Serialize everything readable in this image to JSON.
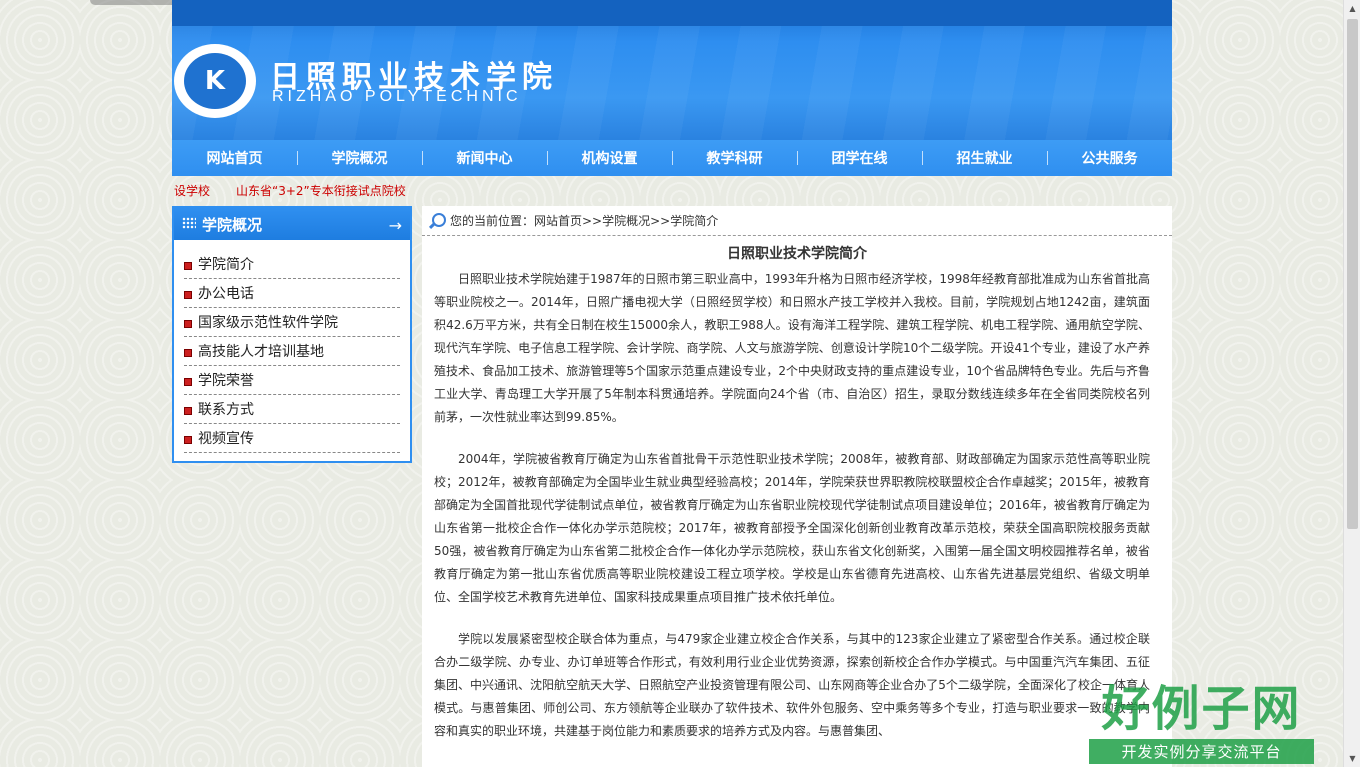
{
  "header": {
    "school_name_cn": "日照职业技术学院",
    "school_name_en": "RIZHAO POLYTECHNIC",
    "logo_mark": "K"
  },
  "nav": {
    "items": [
      "网站首页",
      "学院概况",
      "新闻中心",
      "机构设置",
      "教学科研",
      "团学在线",
      "招生就业",
      "公共服务"
    ]
  },
  "marquee": {
    "items": [
      "设学校",
      "山东省“3+2”专本衔接试点院校"
    ]
  },
  "sidebar": {
    "title": "学院概况",
    "items": [
      "学院简介",
      "办公电话",
      "国家级示范性软件学院",
      "高技能人才培训基地",
      "学院荣誉",
      "联系方式",
      "视频宣传"
    ]
  },
  "breadcrumb": {
    "text": "您的当前位置：网站首页>>学院概况>>学院简介"
  },
  "article": {
    "title": "日照职业技术学院简介",
    "paragraphs": [
      "日照职业技术学院始建于1987年的日照市第三职业高中，1993年升格为日照市经济学校，1998年经教育部批准成为山东省首批高等职业院校之一。2014年，日照广播电视大学（日照经贸学校）和日照水产技工学校并入我校。目前，学院规划占地1242亩，建筑面积42.6万平方米，共有全日制在校生15000余人，教职工988人。设有海洋工程学院、建筑工程学院、机电工程学院、通用航空学院、现代汽车学院、电子信息工程学院、会计学院、商学院、人文与旅游学院、创意设计学院10个二级学院。开设41个专业，建设了水产养殖技术、食品加工技术、旅游管理等5个国家示范重点建设专业，2个中央财政支持的重点建设专业，10个省品牌特色专业。先后与齐鲁工业大学、青岛理工大学开展了5年制本科贯通培养。学院面向24个省（市、自治区）招生，录取分数线连续多年在全省同类院校名列前茅，一次性就业率达到99.85%。",
      "2004年，学院被省教育厅确定为山东省首批骨干示范性职业技术学院；2008年，被教育部、财政部确定为国家示范性高等职业院校；2012年，被教育部确定为全国毕业生就业典型经验高校；2014年，学院荣获世界职教院校联盟校企合作卓越奖；2015年，被教育部确定为全国首批现代学徒制试点单位，被省教育厅确定为山东省职业院校现代学徒制试点项目建设单位；2016年，被省教育厅确定为山东省第一批校企合作一体化办学示范院校；2017年，被教育部授予全国深化创新创业教育改革示范校，荣获全国高职院校服务贡献50强，被省教育厅确定为山东省第二批校企合作一体化办学示范院校，获山东省文化创新奖，入围第一届全国文明校园推荐名单，被省教育厅确定为第一批山东省优质高等职业院校建设工程立项学校。学校是山东省德育先进高校、山东省先进基层党组织、省级文明单位、全国学校艺术教育先进单位、国家科技成果重点项目推广技术依托单位。",
      "学院以发展紧密型校企联合体为重点，与479家企业建立校企合作关系，与其中的123家企业建立了紧密型合作关系。通过校企联合办二级学院、办专业、办订单班等合作形式，有效利用行业企业优势资源，探索创新校企合作办学模式。与中国重汽汽车集团、五征集团、中兴通讯、沈阳航空航天大学、日照航空产业投资管理有限公司、山东网商等企业合办了5个二级学院，全面深化了校企一体育人模式。与惠普集团、师创公司、东方领航等企业联办了软件技术、软件外包服务、空中乘务等多个专业，打造与职业要求一致的教学内容和真实的职业环境，共建基于岗位能力和素质要求的培养方式及内容。与惠普集团、"
    ]
  },
  "watermark": {
    "big": "好例子网",
    "small": "开发实例分享交流平台"
  },
  "colors": {
    "brand_blue": "#2f8ff0",
    "marquee_red": "#cc0000"
  }
}
